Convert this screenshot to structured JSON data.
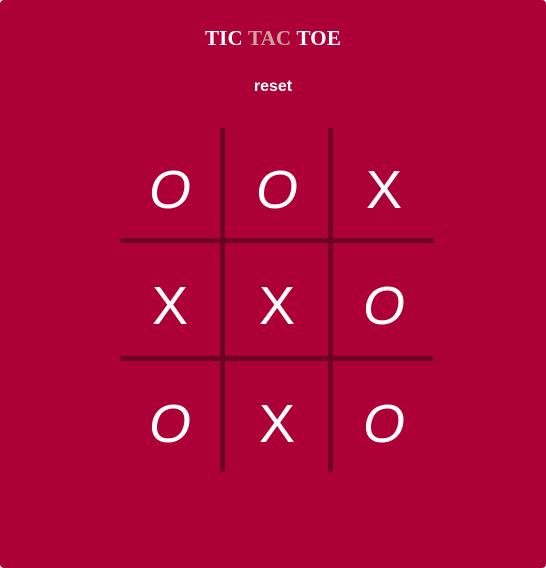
{
  "header": {
    "title_part1": "TIC",
    "title_part2": "TAC",
    "title_part3": "TOE",
    "accent_color": "#c9a79a"
  },
  "controls": {
    "reset_label": "reset"
  },
  "board": {
    "background_color": "#ad0038",
    "line_color": "#6e0028",
    "cells": [
      "O",
      "O",
      "X",
      "X",
      "X",
      "O",
      "O",
      "X",
      "O"
    ]
  }
}
